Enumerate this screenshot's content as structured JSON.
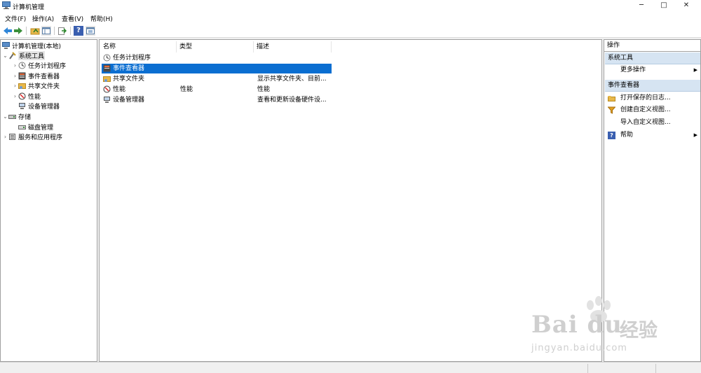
{
  "window": {
    "title": "计算机管理",
    "controls": {
      "minimize": "─",
      "maximize": "□",
      "close": "✕"
    }
  },
  "menu": [
    "文件(F)",
    "操作(A)",
    "查看(V)",
    "帮助(H)"
  ],
  "toolbar": {
    "icons": [
      "back-arrow-icon",
      "forward-arrow-icon",
      "up-folder-icon",
      "show-hide-tree-icon",
      "export-list-icon",
      "help-icon",
      "properties-icon"
    ],
    "help_glyph": "?"
  },
  "tree": {
    "root": "计算机管理(本地)",
    "system_tools": "系统工具",
    "system_children": [
      "任务计划程序",
      "事件查看器",
      "共享文件夹",
      "性能",
      "设备管理器"
    ],
    "storage": "存储",
    "storage_children": [
      "磁盘管理"
    ],
    "services": "服务和应用程序"
  },
  "list": {
    "columns": [
      "名称",
      "类型",
      "描述"
    ],
    "rows": [
      {
        "name": "任务计划程序",
        "type": "",
        "desc": "",
        "icon": "clock-icon"
      },
      {
        "name": "事件查看器",
        "type": "",
        "desc": "",
        "icon": "event-viewer-icon"
      },
      {
        "name": "共享文件夹",
        "type": "",
        "desc": "显示共享文件夹、目前...",
        "icon": "shared-folder-icon"
      },
      {
        "name": "性能",
        "type": "性能",
        "desc": "性能",
        "icon": "performance-icon"
      },
      {
        "name": "设备管理器",
        "type": "",
        "desc": "查看和更新设备硬件设...",
        "icon": "device-manager-icon"
      }
    ],
    "selected_index": 1
  },
  "actions": {
    "title": "操作",
    "section1": "系统工具",
    "section1_items": [
      "更多操作"
    ],
    "section2": "事件查看器",
    "section2_items": [
      "打开保存的日志...",
      "创建自定义视图...",
      "导入自定义视图...",
      "帮助"
    ],
    "submenu_arrow": "▶"
  },
  "watermark": {
    "main": "Bai du",
    "cn": "经验",
    "url": "jingyan.baidu.com"
  },
  "colors": {
    "selection": "#0a6ed1",
    "section_bg": "#d6e4f2",
    "folder": "#e8b84a"
  }
}
